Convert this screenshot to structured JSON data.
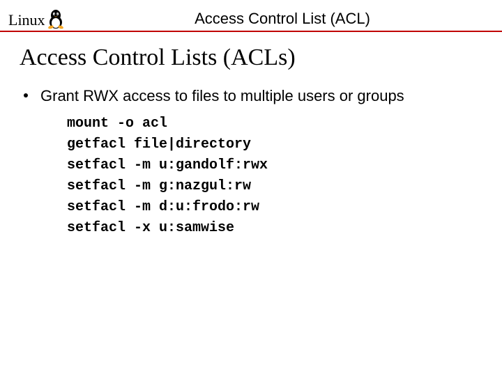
{
  "header": {
    "logo_text": "Linux",
    "title": "Access Control List (ACL)"
  },
  "slide": {
    "title": "Access Control Lists (ACLs)",
    "bullet": "Grant RWX access to files to multiple users or groups",
    "commands": [
      "mount -o acl",
      "getfacl file|directory",
      "setfacl -m u:gandolf:rwx",
      "setfacl -m g:nazgul:rw",
      "setfacl -m d:u:frodo:rw",
      "setfacl -x u:samwise"
    ]
  }
}
